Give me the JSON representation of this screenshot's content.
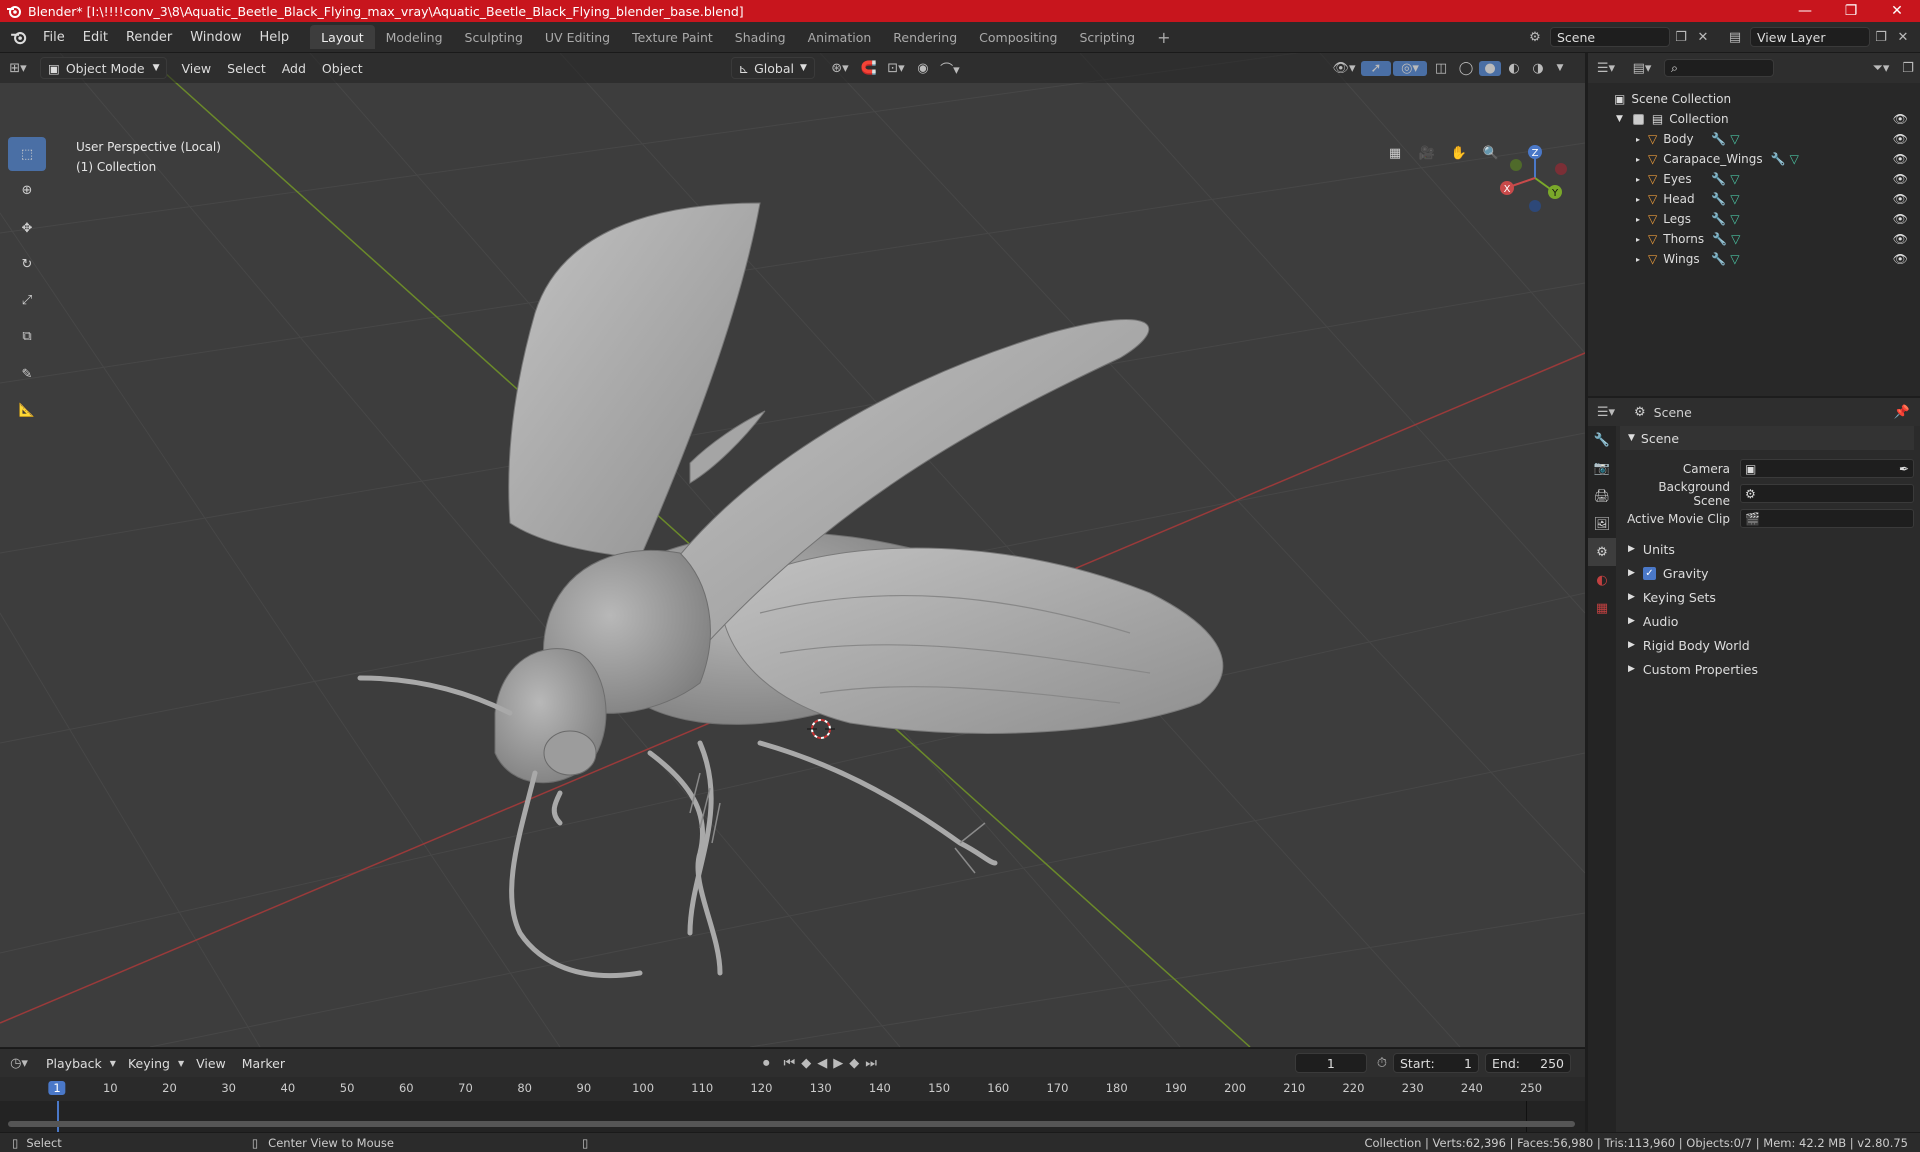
{
  "window": {
    "title": "Blender* [I:\\!!!!conv_3\\8\\Aquatic_Beetle_Black_Flying_max_vray\\Aquatic_Beetle_Black_Flying_blender_base.blend]",
    "minimize": "—",
    "maximize": "❐",
    "close": "✕"
  },
  "menu": [
    "File",
    "Edit",
    "Render",
    "Window",
    "Help"
  ],
  "workspaces": [
    "Layout",
    "Modeling",
    "Sculpting",
    "UV Editing",
    "Texture Paint",
    "Shading",
    "Animation",
    "Rendering",
    "Compositing",
    "Scripting"
  ],
  "active_workspace": "Layout",
  "scene_field": "Scene",
  "view_layer_field": "View Layer",
  "viewport": {
    "mode": "Object Mode",
    "menus": [
      "View",
      "Select",
      "Add",
      "Object"
    ],
    "orientation": "Global",
    "info_line1": "User Perspective (Local)",
    "info_line2": "(1) Collection",
    "gizmo": {
      "x": "X",
      "y": "Y",
      "z": "Z"
    }
  },
  "outliner": {
    "root": "Scene Collection",
    "collection": "Collection",
    "objects": [
      "Body",
      "Carapace_Wings",
      "Eyes",
      "Head",
      "Legs",
      "Thorns",
      "Wings"
    ]
  },
  "properties": {
    "header": "Scene",
    "section": "Scene",
    "fields": [
      {
        "label": "Camera",
        "value": ""
      },
      {
        "label": "Background Scene",
        "value": ""
      },
      {
        "label": "Active Movie Clip",
        "value": ""
      }
    ],
    "panels": [
      "Units",
      "Gravity",
      "Keying Sets",
      "Audio",
      "Rigid Body World",
      "Custom Properties"
    ],
    "gravity_checked": true
  },
  "timeline": {
    "menus": [
      "Playback",
      "Keying",
      "View",
      "Marker"
    ],
    "current_frame": "1",
    "start_label": "Start:",
    "start": "1",
    "end_label": "End:",
    "end": "250",
    "ruler": [
      "1",
      "10",
      "20",
      "30",
      "40",
      "50",
      "60",
      "70",
      "80",
      "90",
      "100",
      "110",
      "120",
      "130",
      "140",
      "150",
      "160",
      "170",
      "180",
      "190",
      "200",
      "210",
      "220",
      "230",
      "240",
      "250"
    ]
  },
  "status": {
    "left1": "Select",
    "left2": "Center View to Mouse",
    "right": "Collection | Verts:62,396 | Faces:56,980 | Tris:113,960 | Objects:0/7 | Mem: 42.2 MB | v2.80.75"
  }
}
